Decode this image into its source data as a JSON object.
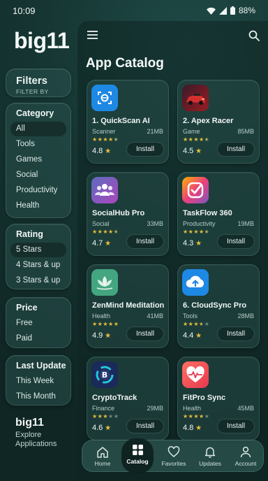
{
  "status_bar": {
    "time": "10:09",
    "battery": "88%"
  },
  "sidebar": {
    "logo": "big11",
    "filters": {
      "title": "Filters",
      "subtitle": "FILTER BY"
    },
    "category": {
      "title": "Category",
      "options": [
        "All",
        "Tools",
        "Games",
        "Social",
        "Productivity",
        "Health"
      ],
      "selected": "All"
    },
    "rating": {
      "title": "Rating",
      "options": [
        "5 Stars",
        "4 Stars & up",
        "3 Stars & up"
      ],
      "selected": "5 Stars"
    },
    "price": {
      "title": "Price",
      "options": [
        "Free",
        "Paid"
      ]
    },
    "last_update": {
      "title": "Last Update",
      "options": [
        "This Week",
        "This Month"
      ]
    },
    "footer": {
      "brand": "big11",
      "tagline": "Explore Applications"
    }
  },
  "main": {
    "title": "App Catalog",
    "install_label": "Install",
    "apps": [
      {
        "name": "1. QuickScan AI",
        "category": "Scanner",
        "size": "21MB",
        "rating": "4.8",
        "stars_filled": 4.5,
        "icon": "scan-icon",
        "color": "#1e88e5"
      },
      {
        "name": "2. Apex Racer",
        "category": "Game",
        "size": "85MB",
        "rating": "4.5",
        "stars_filled": 4.5,
        "icon": "race-car-icon",
        "color": "#c62828"
      },
      {
        "name": "SocialHub Pro",
        "category": "Social",
        "size": "33MB",
        "rating": "4.7",
        "stars_filled": 4.5,
        "icon": "people-icon",
        "color": "#7e57c2"
      },
      {
        "name": "TaskFlow 360",
        "category": "Productivity",
        "size": "19MB",
        "rating": "4.3",
        "stars_filled": 4.5,
        "icon": "check-circle-icon",
        "color": "#ec407a"
      },
      {
        "name": "ZenMind Meditation",
        "category": "Health",
        "size": "41MB",
        "rating": "4.9",
        "stars_filled": 5,
        "icon": "lotus-icon",
        "color": "#43a680"
      },
      {
        "name": "6. CloudSync Pro",
        "category": "Tools",
        "size": "28MB",
        "rating": "4.4",
        "stars_filled": 3.5,
        "icon": "cloud-upload-icon",
        "color": "#1e88e5"
      },
      {
        "name": "CryptoTrack",
        "category": "Finance",
        "size": "29MB",
        "rating": "4.6",
        "stars_filled": 3,
        "icon": "bitcoin-icon",
        "color": "#1a2a5a"
      },
      {
        "name": "FitPro Sync",
        "category": "Health",
        "size": "45MB",
        "rating": "4.8",
        "stars_filled": 4,
        "icon": "heart-pulse-icon",
        "color": "#e53950"
      }
    ]
  },
  "bottom_nav": {
    "items": [
      {
        "label": "Home",
        "icon": "home-icon"
      },
      {
        "label": "Catalog",
        "icon": "grid-icon",
        "active": true
      },
      {
        "label": "Favorites",
        "icon": "heart-icon"
      },
      {
        "label": "Updates",
        "icon": "bell-icon"
      },
      {
        "label": "Account",
        "icon": "person-icon"
      }
    ]
  }
}
